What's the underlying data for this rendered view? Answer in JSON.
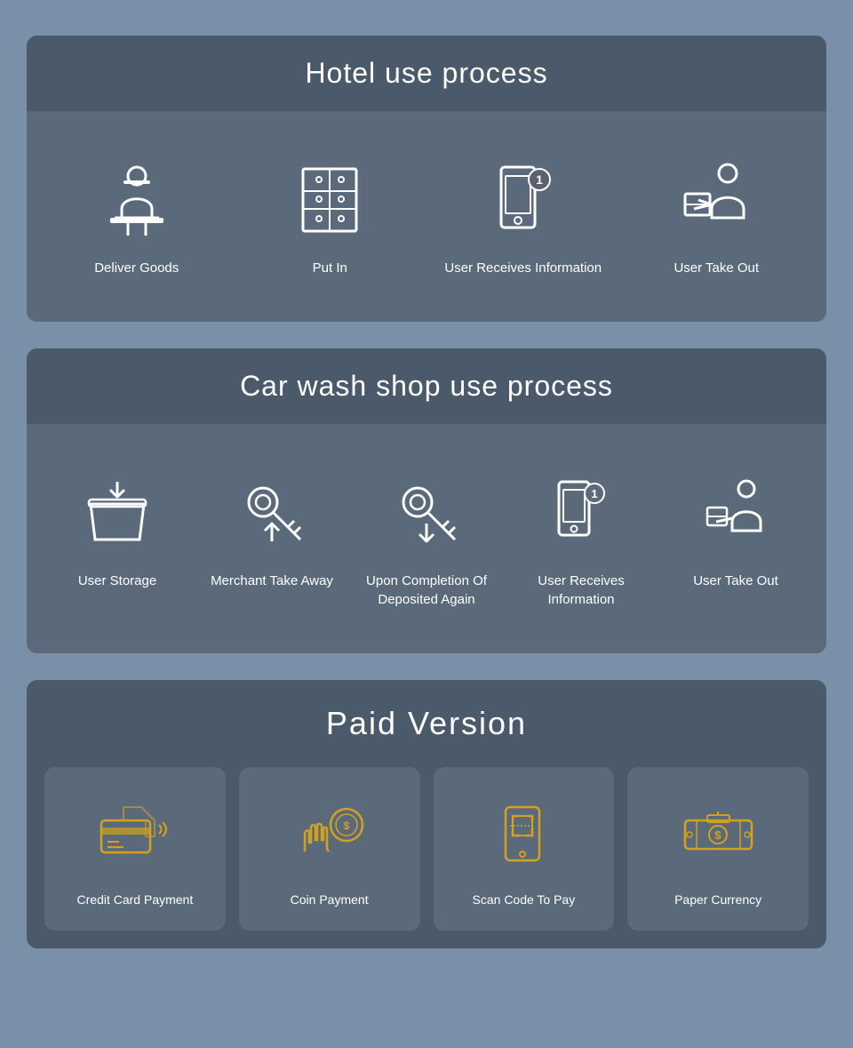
{
  "hotel_section": {
    "title": "Hotel use process",
    "items": [
      {
        "id": "deliver-goods",
        "label": "Deliver Goods",
        "icon": "delivery-person"
      },
      {
        "id": "put-in",
        "label": "Put In",
        "icon": "locker"
      },
      {
        "id": "user-receives",
        "label": "User Receives Information",
        "icon": "phone-notification"
      },
      {
        "id": "user-take-out",
        "label": "User Take Out",
        "icon": "person-box"
      }
    ]
  },
  "carwash_section": {
    "title": "Car wash shop use process",
    "items": [
      {
        "id": "user-storage",
        "label": "User Storage",
        "icon": "storage-basket"
      },
      {
        "id": "merchant-take-away",
        "label": "Merchant Take Away",
        "icon": "key-up"
      },
      {
        "id": "upon-completion",
        "label": "Upon Completion Of Deposited Again",
        "icon": "key-down"
      },
      {
        "id": "user-receives-2",
        "label": "User Receives Information",
        "icon": "phone-notification-2"
      },
      {
        "id": "user-take-out-2",
        "label": "User Take Out",
        "icon": "person-box-2"
      }
    ]
  },
  "paid_section": {
    "title": "Paid Version",
    "items": [
      {
        "id": "credit-card",
        "label": "Credit Card Payment",
        "icon": "credit-card"
      },
      {
        "id": "coin-payment",
        "label": "Coin Payment",
        "icon": "coin-payment"
      },
      {
        "id": "scan-code",
        "label": "Scan Code To Pay",
        "icon": "scan-code"
      },
      {
        "id": "paper-currency",
        "label": "Paper Currency",
        "icon": "paper-currency"
      }
    ]
  }
}
